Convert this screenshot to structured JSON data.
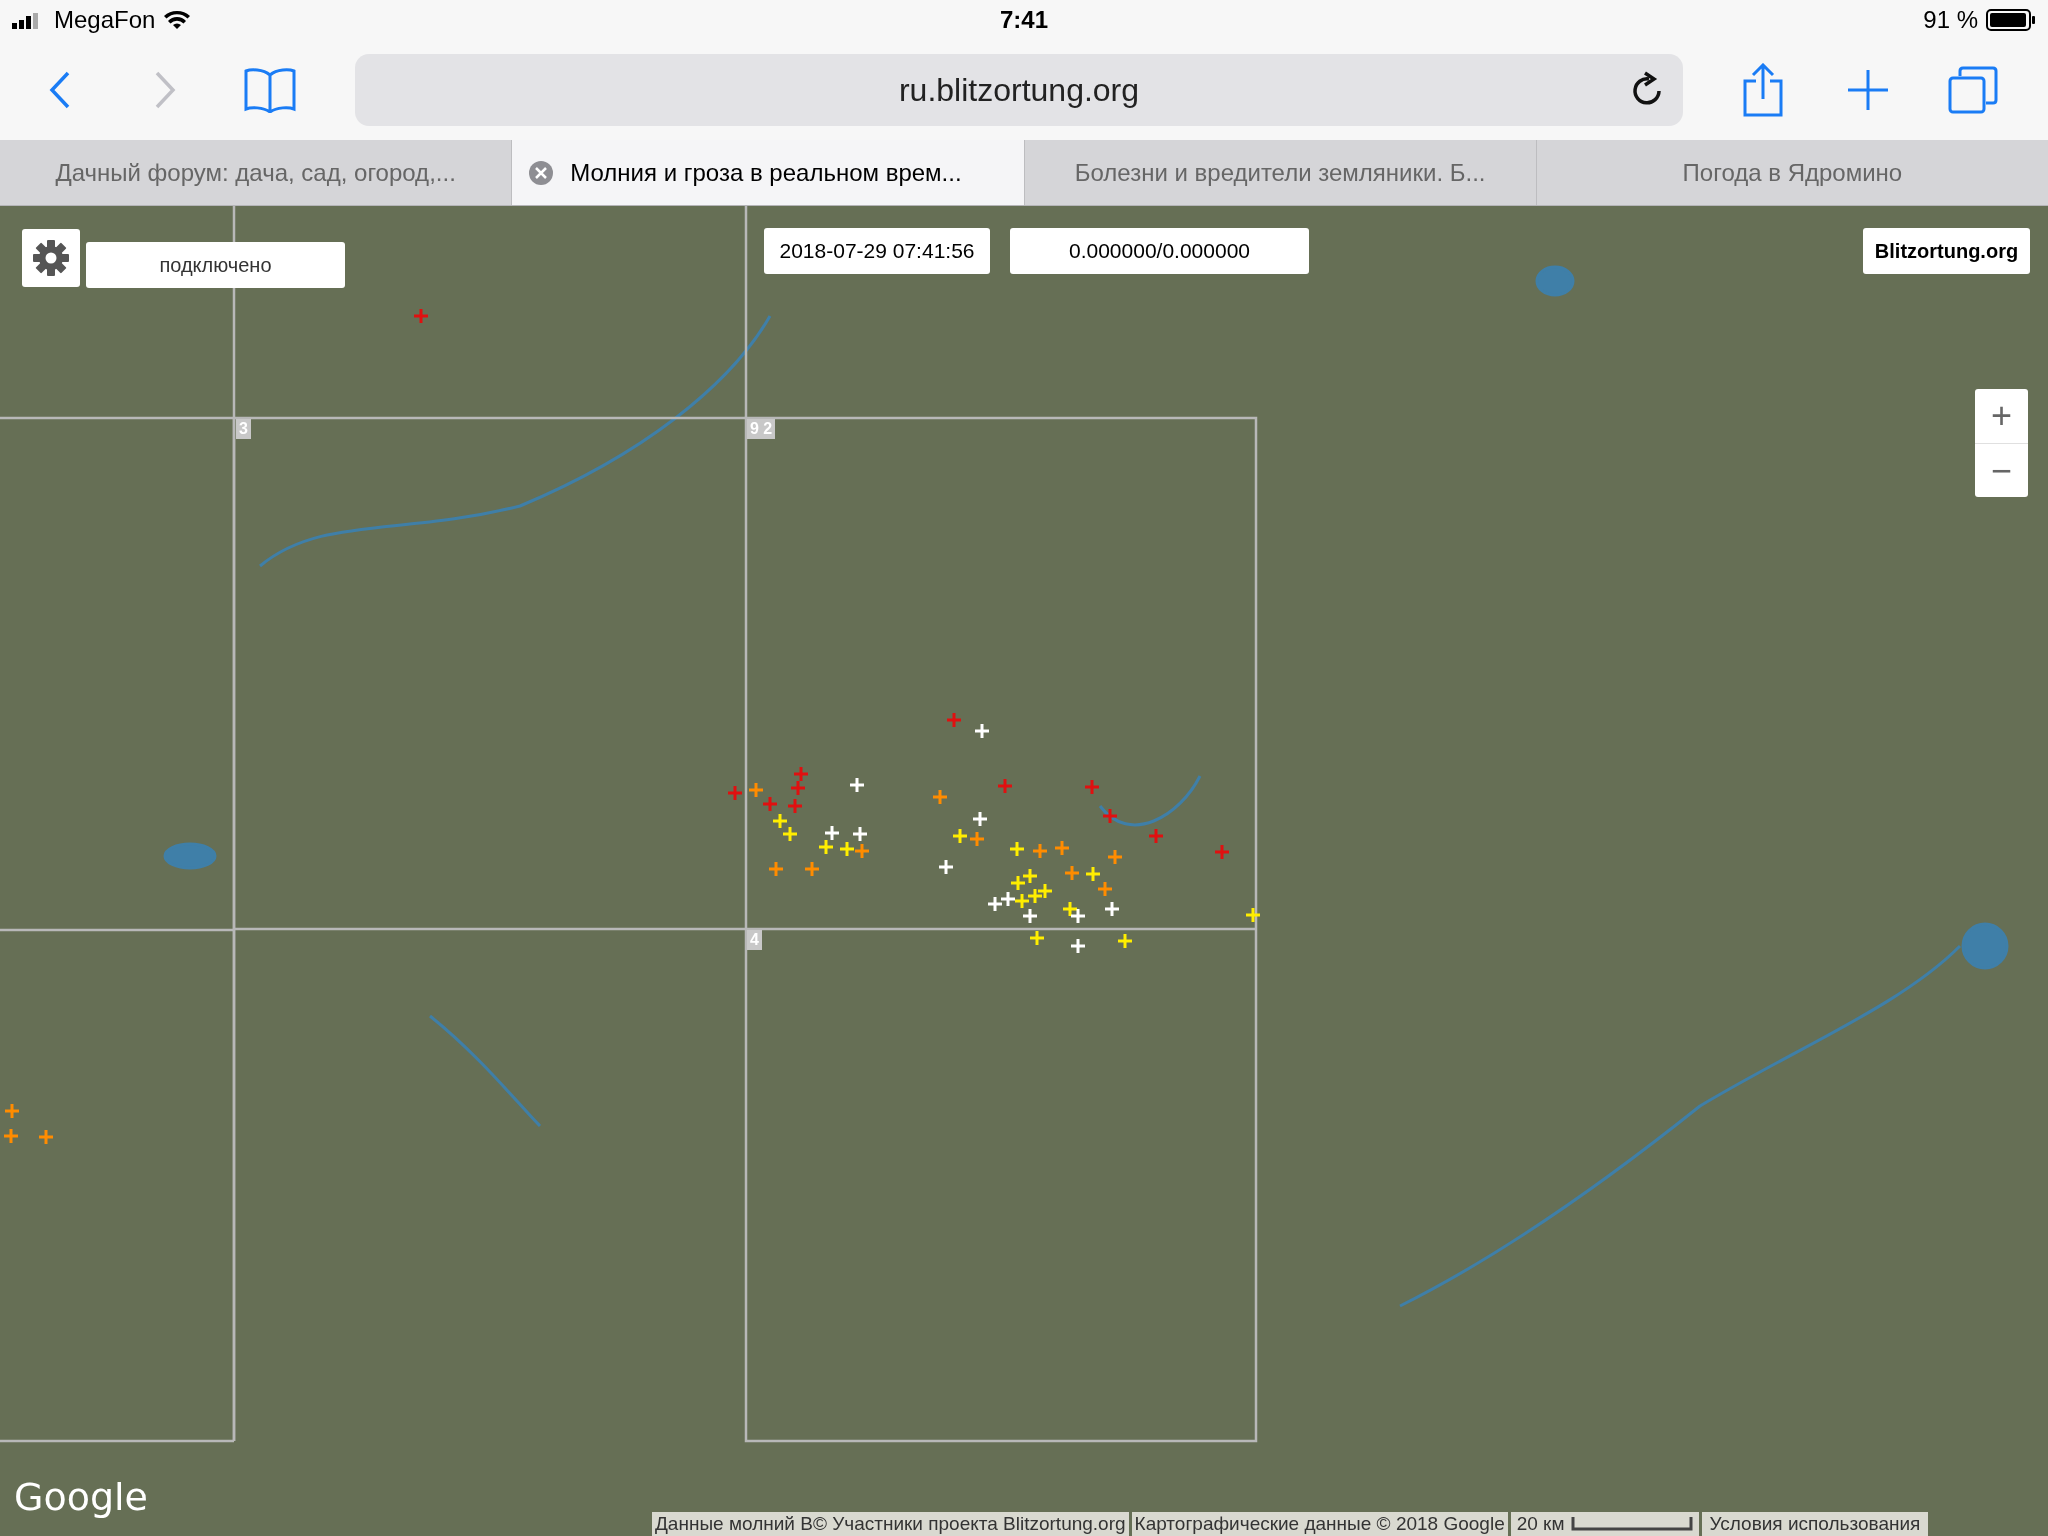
{
  "status_bar": {
    "carrier": "MegaFon",
    "time": "7:41",
    "battery": "91 %"
  },
  "toolbar": {
    "url": "ru.blitzortung.org"
  },
  "tabs": [
    {
      "title": "Дачный форум: дача, сад, огород,...",
      "selected": false
    },
    {
      "title": "Молния и гроза в реальном врем...",
      "selected": true
    },
    {
      "title": "Болезни и вредители земляники. Б...",
      "selected": false
    },
    {
      "title": "Погода в Ядромино",
      "selected": false
    }
  ],
  "map": {
    "status": "подключено",
    "timestamp": "2018-07-29 07:41:56",
    "coordinates": "0.000000/0.000000",
    "site_link": "Blitzortung.org",
    "grid_labels": [
      "3",
      "9 2",
      "4"
    ],
    "zoom": {
      "plus": "+",
      "minus": "−"
    },
    "google_logo": "Google",
    "attribution": [
      "Данные молний В© Участники проекта Blitzortung.org",
      "Картографические данные © 2018 Google"
    ],
    "scale": "20 км",
    "terms": "Условия использования"
  }
}
